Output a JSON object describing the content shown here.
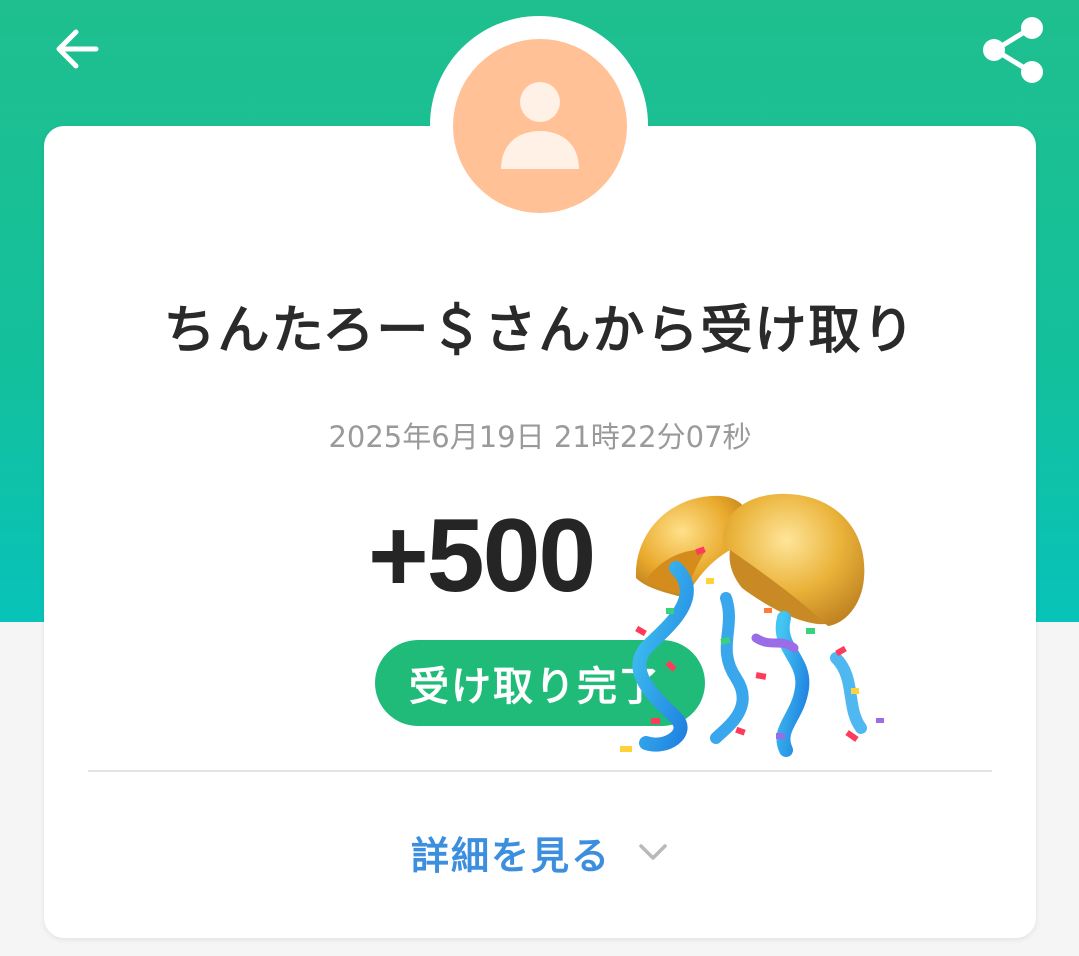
{
  "header": {
    "back_icon": "arrow-left-icon",
    "share_icon": "share-icon",
    "colors": {
      "gradient_top": "#1fbf8e",
      "gradient_bottom": "#08c3b9"
    }
  },
  "profile": {
    "avatar_icon": "person-icon",
    "avatar_color": "#ffc195"
  },
  "transaction": {
    "title": "ちんたろー＄さんから受け取り",
    "timestamp": "2025年6月19日 21時22分07秒",
    "amount": "+500",
    "status": "受け取り完了",
    "status_color": "#21bb79"
  },
  "details": {
    "label": "詳細を見る",
    "icon": "chevron-down-icon",
    "color": "#3c8fde"
  }
}
